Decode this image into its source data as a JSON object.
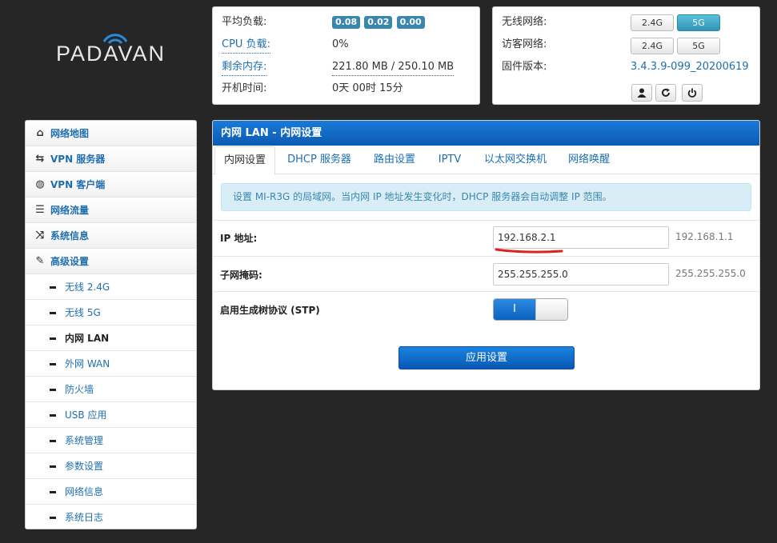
{
  "logo": {
    "text": "PADAVAN"
  },
  "status": {
    "load_label": "平均负载:",
    "load_values": [
      "0.08",
      "0.02",
      "0.00"
    ],
    "cpu_label": "CPU 负载:",
    "cpu_value": "0%",
    "mem_label": "剩余内存:",
    "mem_value": "221.80 MB / 250.10 MB",
    "uptime_label": "开机时间:",
    "uptime_value": "0天 00时 15分"
  },
  "wireless": {
    "wifi_label": "无线网络:",
    "guest_label": "访客网络:",
    "firmware_label": "固件版本:",
    "firmware_value": "3.4.3.9-099_20200619",
    "band_24": "2.4G",
    "band_5": "5G"
  },
  "sidebar": {
    "items": [
      {
        "label": "网络地图",
        "icon": "home-icon",
        "glyph": "⌂"
      },
      {
        "label": "VPN 服务器",
        "icon": "retweet-icon",
        "glyph": "⇆"
      },
      {
        "label": "VPN 客户端",
        "icon": "globe-icon",
        "glyph": "◍"
      },
      {
        "label": "网络流量",
        "icon": "list-icon",
        "glyph": "☰"
      },
      {
        "label": "系统信息",
        "icon": "random-icon",
        "glyph": "⤨"
      },
      {
        "label": "高级设置",
        "icon": "wrench-icon",
        "glyph": "✎"
      }
    ],
    "subitems": [
      "无线 2.4G",
      "无线 5G",
      "内网 LAN",
      "外网 WAN",
      "防火墙",
      "USB 应用",
      "系统管理",
      "参数设置",
      "网络信息",
      "系统日志"
    ]
  },
  "main": {
    "title": "内网 LAN - 内网设置",
    "tabs": [
      "内网设置",
      "DHCP 服务器",
      "路由设置",
      "IPTV",
      "以太网交换机",
      "网络唤醒"
    ],
    "notice": "设置 MI-R3G 的局域网。当内网 IP 地址发生变化时，DHCP 服务器会自动调整 IP 范围。",
    "ip_label": "IP 地址:",
    "ip_value": "192.168.2.1",
    "ip_default": "192.168.1.1",
    "mask_label": "子网掩码:",
    "mask_value": "255.255.255.0",
    "mask_default": "255.255.255.0",
    "stp_label": "启用生成树协议 (STP)",
    "stp_on_text": "I",
    "apply_label": "应用设置"
  },
  "colors": {
    "accent": "#0a5bb3",
    "link": "#1f6fb0",
    "badge": "#3a87ad",
    "annotation": "#e0201c"
  }
}
